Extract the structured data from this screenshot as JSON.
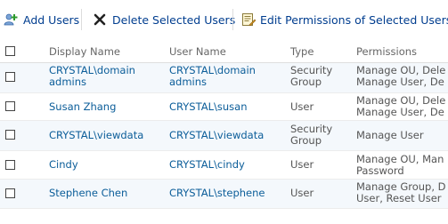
{
  "toolbar": {
    "add_users": "Add Users",
    "delete_selected": "Delete Selected Users",
    "edit_permissions": "Edit Permissions of Selected Users"
  },
  "columns": {
    "display_name": "Display Name",
    "user_name": "User Name",
    "type": "Type",
    "permissions": "Permissions"
  },
  "rows": [
    {
      "display_name": [
        "CRYSTAL\\domain",
        "admins"
      ],
      "user_name": [
        "CRYSTAL\\domain",
        "admins"
      ],
      "type": [
        "Security",
        "Group"
      ],
      "permissions": [
        "Manage OU, Dele",
        "Manage User, De"
      ]
    },
    {
      "display_name": [
        "Susan Zhang"
      ],
      "user_name": [
        "CRYSTAL\\susan"
      ],
      "type": [
        "User"
      ],
      "permissions": [
        "Manage OU, Dele",
        "Manage User, De"
      ]
    },
    {
      "display_name": [
        "CRYSTAL\\viewdata"
      ],
      "user_name": [
        "CRYSTAL\\viewdata"
      ],
      "type": [
        "Security",
        "Group"
      ],
      "permissions": [
        "Manage User"
      ]
    },
    {
      "display_name": [
        "Cindy"
      ],
      "user_name": [
        "CRYSTAL\\cindy"
      ],
      "type": [
        "User"
      ],
      "permissions": [
        "Manage OU, Man",
        "Password"
      ]
    },
    {
      "display_name": [
        "Stephene Chen"
      ],
      "user_name": [
        "CRYSTAL\\stephene"
      ],
      "type": [
        "User"
      ],
      "permissions": [
        "Manage Group, D",
        "User, Reset User"
      ]
    }
  ]
}
